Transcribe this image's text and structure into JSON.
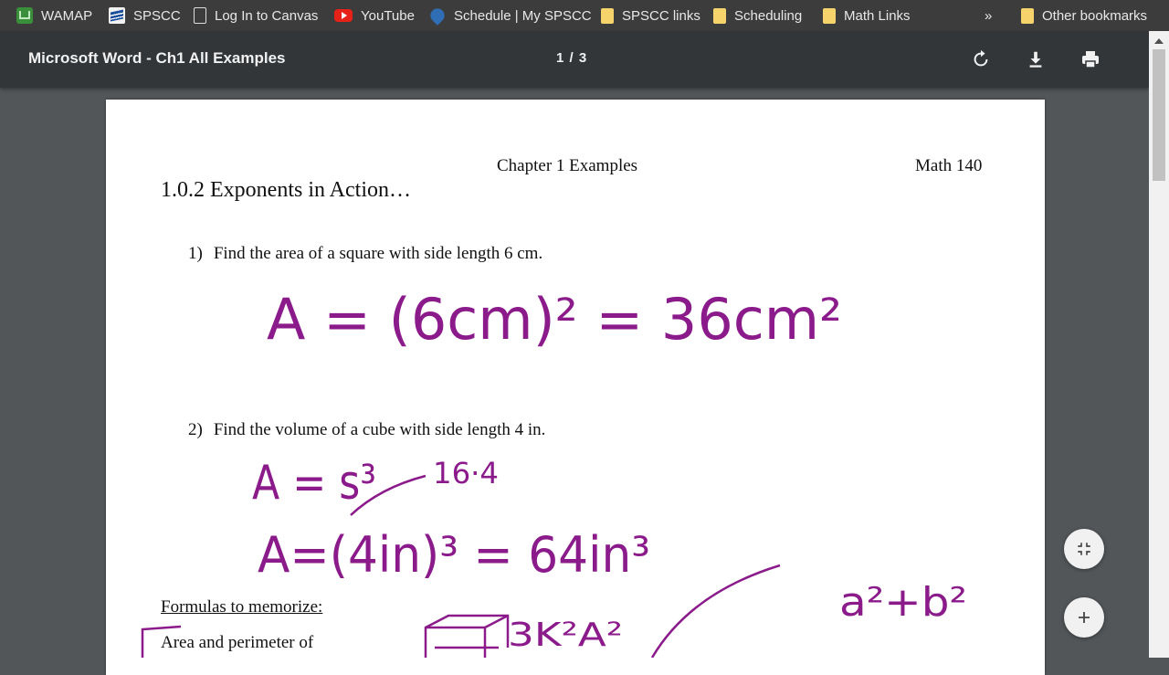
{
  "bookmarks": {
    "items": [
      {
        "label": "WAMAP",
        "icon": "wamap-icon"
      },
      {
        "label": "SPSCC",
        "icon": "spscc-icon"
      },
      {
        "label": "Log In to Canvas",
        "icon": "page-icon"
      },
      {
        "label": "YouTube",
        "icon": "youtube-icon"
      },
      {
        "label": "Schedule | My SPSCC",
        "icon": "drupal-icon"
      },
      {
        "label": "SPSCC links",
        "icon": "folder-icon"
      },
      {
        "label": "Scheduling",
        "icon": "folder-icon"
      },
      {
        "label": "Math Links",
        "icon": "folder-icon"
      }
    ],
    "overflow": "»",
    "other": "Other bookmarks"
  },
  "toolbar": {
    "title": "Microsoft Word - Ch1 All Examples",
    "page_indicator": "1  /  3"
  },
  "document": {
    "header_center": "Chapter 1 Examples",
    "header_right": "Math 140",
    "section_title": "1.0.2 Exponents in Action…",
    "q1_num": "1)",
    "q1_text": "Find the area of a square with side length 6 cm.",
    "q2_num": "2)",
    "q2_text": "Find the volume of a cube with side length 4 in.",
    "formulas_heading": "Formulas to memorize:",
    "area_perimeter": "Area and perimeter of"
  },
  "handwriting": {
    "eq1": "A = (6cm)² = 36cm²",
    "eq2a": "A = s³",
    "eq2_note": "16·4",
    "eq2b": "A=(4in)³ = 64in³",
    "pythag": "a²+b²",
    "sketch": "3K²A²",
    "ink_color": "#8b1a8b"
  },
  "colors": {
    "bookmarks_bg": "#3c3c3c",
    "toolbar_bg": "#323639",
    "viewer_bg": "#525659",
    "ink": "#8b1a8b"
  }
}
